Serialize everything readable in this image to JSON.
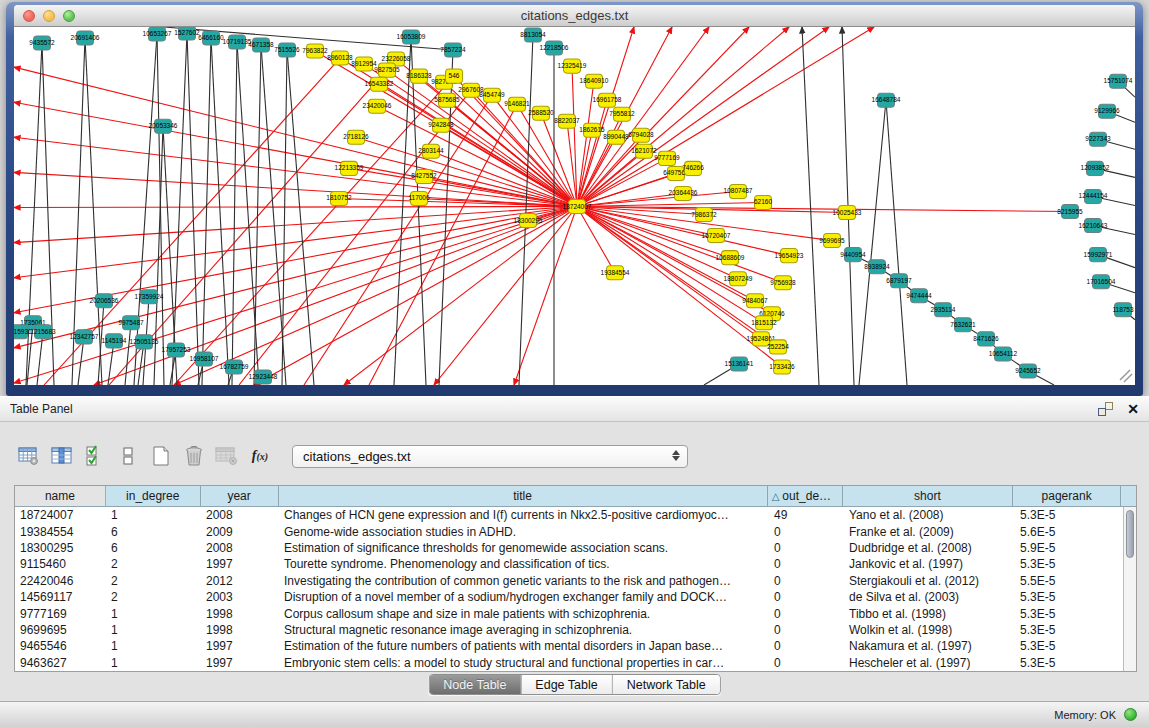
{
  "window": {
    "title": "citations_edges.txt",
    "traffic_lights": [
      "close",
      "minimize",
      "zoom"
    ]
  },
  "table_panel": {
    "title": "Table Panel",
    "header_icons": [
      "float-panel-icon",
      "close-panel-icon"
    ],
    "toolbar": {
      "icons": [
        "table-options-icon",
        "show-column-icon",
        "select-all-columns-icon",
        "row-height-icon",
        "new-table-icon",
        "delete-table-icon",
        "import-table-disabled-icon",
        "function-builder-icon"
      ],
      "table_selector_value": "citations_edges.txt"
    },
    "table": {
      "columns": [
        {
          "label": "name"
        },
        {
          "label": "in_degree"
        },
        {
          "label": "year"
        },
        {
          "label": "title"
        },
        {
          "label": "out_de…",
          "sort_indicator": "△"
        },
        {
          "label": "short"
        },
        {
          "label": "pagerank"
        }
      ],
      "rows": [
        {
          "name": "18724007",
          "in_degree": "1",
          "year": "2008",
          "title": "Changes of HCN gene expression and I(f) currents in Nkx2.5-positive cardiomyoc…",
          "out_degree": "49",
          "short": "Yano et al. (2008)",
          "pagerank": "5.3E-5"
        },
        {
          "name": "19384554",
          "in_degree": "6",
          "year": "2009",
          "title": "Genome-wide association studies in ADHD.",
          "out_degree": "0",
          "short": "Franke et al. (2009)",
          "pagerank": "5.6E-5"
        },
        {
          "name": "18300295",
          "in_degree": "6",
          "year": "2008",
          "title": "Estimation of significance thresholds for genomewide association scans.",
          "out_degree": "0",
          "short": "Dudbridge et al. (2008)",
          "pagerank": "5.9E-5"
        },
        {
          "name": "9115460",
          "in_degree": "2",
          "year": "1997",
          "title": "Tourette syndrome. Phenomenology and classification of tics.",
          "out_degree": "0",
          "short": "Jankovic et al. (1997)",
          "pagerank": "5.3E-5"
        },
        {
          "name": "22420046",
          "in_degree": "2",
          "year": "2012",
          "title": "Investigating the contribution of common genetic variants to the risk and pathogen…",
          "out_degree": "0",
          "short": "Stergiakouli et al. (2012)",
          "pagerank": "5.5E-5"
        },
        {
          "name": "14569117",
          "in_degree": "2",
          "year": "2003",
          "title": "Disruption of a novel member of a sodium/hydrogen exchanger family and DOCK…",
          "out_degree": "0",
          "short": "de Silva et al. (2003)",
          "pagerank": "5.3E-5"
        },
        {
          "name": "9777169",
          "in_degree": "1",
          "year": "1998",
          "title": "Corpus callosum shape and size in male patients with schizophrenia.",
          "out_degree": "0",
          "short": "Tibbo et al. (1998)",
          "pagerank": "5.3E-5"
        },
        {
          "name": "9699695",
          "in_degree": "1",
          "year": "1998",
          "title": "Structural magnetic resonance image averaging in schizophrenia.",
          "out_degree": "0",
          "short": "Wolkin et al. (1998)",
          "pagerank": "5.3E-5"
        },
        {
          "name": "9465546",
          "in_degree": "1",
          "year": "1997",
          "title": "Estimation of the future numbers of patients with mental disorders in Japan base…",
          "out_degree": "0",
          "short": "Nakamura et al. (1997)",
          "pagerank": "5.3E-5"
        },
        {
          "name": "9463627",
          "in_degree": "1",
          "year": "1997",
          "title": "Embryonic stem cells: a model to study structural and functional properties in car…",
          "out_degree": "0",
          "short": "Hescheler et al. (1997)",
          "pagerank": "5.3E-5"
        }
      ]
    },
    "tabs": [
      {
        "label": "Node Table",
        "selected": true
      },
      {
        "label": "Edge Table",
        "selected": false
      },
      {
        "label": "Network Table",
        "selected": false
      }
    ]
  },
  "status_bar": {
    "memory_label": "Memory: OK",
    "status_color": "#35b335"
  },
  "colors": {
    "node_yellow": "#f7ee00",
    "node_yellow_border": "#a8a000",
    "node_teal": "#23a8a4",
    "node_teal_border": "#6f7f7f",
    "edge_red": "#ee1111",
    "edge_black": "#2f2f2f",
    "frame_blue": "#2b4885",
    "header_blue": "#c6e2ee"
  },
  "graph": {
    "nodes": [
      [
        "18724007",
        563,
        179,
        "y"
      ],
      [
        "7963822",
        301,
        24,
        "y"
      ],
      [
        "8960128",
        326,
        31,
        "y"
      ],
      [
        "8912954",
        350,
        37,
        "y"
      ],
      [
        "23226058",
        382,
        32,
        "y"
      ],
      [
        "9827505",
        373,
        43,
        "y"
      ],
      [
        "16543382",
        365,
        57,
        "y"
      ],
      [
        "23420046",
        363,
        79,
        "y"
      ],
      [
        "8186328",
        405,
        49,
        "y"
      ],
      [
        "9827508",
        430,
        55,
        "y"
      ],
      [
        "546",
        440,
        49,
        "y"
      ],
      [
        "2967608",
        457,
        63,
        "y"
      ],
      [
        "5875685",
        433,
        73,
        "y"
      ],
      [
        "8454749",
        478,
        68,
        "y"
      ],
      [
        "9146821",
        503,
        77,
        "y"
      ],
      [
        "2588520",
        527,
        86,
        "y"
      ],
      [
        "8822037",
        553,
        94,
        "y"
      ],
      [
        "12325419",
        558,
        39,
        "y"
      ],
      [
        "18640910",
        580,
        54,
        "y"
      ],
      [
        "16961758",
        593,
        73,
        "y"
      ],
      [
        "1862615",
        578,
        103,
        "y"
      ],
      [
        "7955812",
        608,
        87,
        "y"
      ],
      [
        "8990448",
        602,
        110,
        "y"
      ],
      [
        "6794028",
        627,
        108,
        "y"
      ],
      [
        "1621072",
        630,
        124,
        "y"
      ],
      [
        "9777169",
        653,
        131,
        "y"
      ],
      [
        "6497568",
        662,
        146,
        "y"
      ],
      [
        "746266",
        679,
        141,
        "y"
      ],
      [
        "20364436",
        669,
        166,
        "y"
      ],
      [
        "10807487",
        724,
        164,
        "y"
      ],
      [
        "62160",
        749,
        175,
        "y"
      ],
      [
        "7986372",
        690,
        187,
        "y"
      ],
      [
        "16720407",
        702,
        208,
        "y"
      ],
      [
        "10025433",
        833,
        185,
        "y"
      ],
      [
        "10688609",
        716,
        230,
        "y"
      ],
      [
        "18807249",
        724,
        251,
        "y"
      ],
      [
        "19654923",
        775,
        228,
        "y"
      ],
      [
        "9699695",
        818,
        213,
        "y"
      ],
      [
        "9756928",
        769,
        255,
        "y"
      ],
      [
        "9484067",
        741,
        273,
        "y"
      ],
      [
        "6120746",
        758,
        286,
        "y"
      ],
      [
        "1815132",
        750,
        295,
        "y"
      ],
      [
        "19524861",
        747,
        311,
        "y"
      ],
      [
        "252254",
        764,
        319,
        "y"
      ],
      [
        "1733426",
        768,
        339,
        "y"
      ],
      [
        "19384554",
        601,
        245,
        "y"
      ],
      [
        "18300295",
        514,
        193,
        "y"
      ],
      [
        "2718126",
        342,
        110,
        "y"
      ],
      [
        "12213359",
        335,
        141,
        "y"
      ],
      [
        "2803144",
        417,
        124,
        "y"
      ],
      [
        "9242848",
        427,
        98,
        "y"
      ],
      [
        "8427552",
        410,
        149,
        "y"
      ],
      [
        "1810752",
        325,
        171,
        "y"
      ],
      [
        "117006",
        405,
        171,
        "y"
      ],
      [
        "9435572",
        28,
        16,
        "t"
      ],
      [
        "20691406",
        71,
        11,
        "t"
      ],
      [
        "10653267",
        143,
        7,
        "t"
      ],
      [
        "1527602",
        173,
        6,
        "t"
      ],
      [
        "6466160",
        197,
        11,
        "t"
      ],
      [
        "10719135",
        223,
        15,
        "t"
      ],
      [
        "4671358",
        247,
        18,
        "t"
      ],
      [
        "7515526",
        273,
        23,
        "t"
      ],
      [
        "16053809",
        397,
        10,
        "t"
      ],
      [
        "7857224",
        439,
        23,
        "t"
      ],
      [
        "8813054",
        519,
        8,
        "t"
      ],
      [
        "12218506",
        540,
        21,
        "t"
      ],
      [
        "20053346",
        149,
        99,
        "t"
      ],
      [
        "1735061",
        19,
        295,
        "t"
      ],
      [
        "3915931",
        5,
        304,
        "t"
      ],
      [
        "1215683",
        29,
        304,
        "t"
      ],
      [
        "20206536",
        90,
        273,
        "t"
      ],
      [
        "17359924",
        135,
        269,
        "t"
      ],
      [
        "9975487",
        117,
        295,
        "t"
      ],
      [
        "12342757",
        70,
        309,
        "t"
      ],
      [
        "1145194",
        100,
        313,
        "t"
      ],
      [
        "12505135",
        130,
        314,
        "t"
      ],
      [
        "17957253",
        162,
        322,
        "t"
      ],
      [
        "16958107",
        190,
        331,
        "t"
      ],
      [
        "16782759",
        220,
        339,
        "t"
      ],
      [
        "12923448",
        249,
        349,
        "t"
      ],
      [
        "16648784",
        872,
        73,
        "t"
      ],
      [
        "15751074",
        1104,
        54,
        "t"
      ],
      [
        "9129966",
        1093,
        84,
        "t"
      ],
      [
        "9227343",
        1084,
        112,
        "t"
      ],
      [
        "12093852",
        1081,
        141,
        "t"
      ],
      [
        "12444154",
        1079,
        169,
        "t"
      ],
      [
        "8215955",
        1056,
        184,
        "t"
      ],
      [
        "16210643",
        1079,
        198,
        "t"
      ],
      [
        "9440954",
        839,
        227,
        "t"
      ],
      [
        "8938924",
        863,
        239,
        "t"
      ],
      [
        "6879197",
        885,
        253,
        "t"
      ],
      [
        "9474444",
        905,
        268,
        "t"
      ],
      [
        "2935114",
        929,
        282,
        "t"
      ],
      [
        "7632621",
        949,
        297,
        "t"
      ],
      [
        "8471626",
        972,
        311,
        "t"
      ],
      [
        "10654112",
        989,
        326,
        "t"
      ],
      [
        "9245652",
        1014,
        343,
        "t"
      ],
      [
        "15136141",
        725,
        336,
        "t"
      ],
      [
        "15992971",
        1084,
        227,
        "t"
      ],
      [
        "17016504",
        1087,
        254,
        "t"
      ],
      [
        "118753",
        1109,
        282,
        "t"
      ]
    ],
    "edges": [
      "18724007>7963822:r",
      "18724007>8960128:r",
      "18724007>8912954:r",
      "18724007>23226058:r",
      "18724007>9827505:r",
      "18724007>16543382:r",
      "18724007>23420046:r",
      "18724007>8186328:r",
      "18724007>9827508:r",
      "18724007>546:r",
      "18724007>2967608:r",
      "18724007>5875685:r",
      "18724007>8454749:r",
      "18724007>9146821:r",
      "18724007>2588520:r",
      "18724007>8822037:r",
      "18724007>12325419:r",
      "18724007>18640910:r",
      "18724007>16961758:r",
      "18724007>1862615:r",
      "18724007>7955812:r",
      "18724007>8990448:r",
      "18724007>6794028:r",
      "18724007>1621072:r",
      "18724007>9777169:r",
      "18724007>6497568:r",
      "18724007>746266:r",
      "18724007>20364436:r",
      "18724007>10807487:r",
      "18724007>62160:r",
      "18724007>7986372:r",
      "18724007>16720407:r",
      "18724007>10025433:r",
      "18724007>10688609:r",
      "18724007>18807249:r",
      "18724007>19654923:r",
      "18724007>9699695:r",
      "18724007>9756928:r",
      "18724007>9484067:r",
      "18724007>6120746:r",
      "18724007>1815132:r",
      "18724007>19524861:r",
      "18724007>252254:r",
      "18724007>1733426:r",
      "18724007>19384554:r",
      "18724007>18300295:r",
      "18724007>2718126:r",
      "18724007>12213359:r",
      "18724007>2803144:r",
      "18724007>9242848:r",
      "18724007>8427552:r",
      "18724007>1810752:r",
      "18724007>117006:r",
      "18724007>0,40:r",
      "18724007>0,75:r",
      "18724007>0,110:r",
      "18724007>0,145:r",
      "18724007>0,180:r",
      "18724007>0,215:r",
      "18724007>0,250:r",
      "18724007>0,285:r",
      "18724007>0,320:r",
      "18724007>0,355:r",
      "18724007>80,357:r",
      "18724007>160,357:r",
      "18724007>240,357:r",
      "18724007>330,357:r",
      "18724007>420,357:r",
      "18724007>500,357:r",
      "18724007>620,0:r",
      "18724007>658,0:r",
      "18724007>695,0:r",
      "18724007>735,0:r",
      "18724007>775,0:r",
      "18724007>815,0:r",
      "18724007>860,0:r",
      "18724007>8215955:r",
      "30,357>8960128:r",
      "95,357>23226058:r",
      "160,357>546:r",
      "225,357>2967608:r",
      "290,357>8454749:r",
      "355,357>9146821:r",
      "12,357>9435572:k",
      "40,357>9435572:k",
      "58,357>20691406:k",
      "88,357>20691406:k",
      "120,357>10653267:k",
      "150,357>10653267:k",
      "158,357>1527602:k",
      "185,357>1527602:k",
      "188,357>6466160:k",
      "215,357>6466160:k",
      "218,357>10719135:k",
      "245,357>10719135:k",
      "240,357>4671358:k",
      "272,357>4671358:k",
      "268,357>7515526:k",
      "300,357>7515526:k",
      "380,357>16053809:k",
      "412,357>16053809:k",
      "425,357>7857224:k",
      "150,0>7857224:k",
      "505,357>8813054:k",
      "540,357>12218506:k",
      "140,357>20053346:k",
      "163,357>20053346:k",
      "13,357>1735061:k",
      "23,357>1215683:k",
      "84,357>20206536:k",
      "129,357>17359924:k",
      "111,357>9975487:k",
      "64,357>12342757:k",
      "94,357>1145194:k",
      "124,357>12505135:k",
      "156,357>17957253:k",
      "184,357>16958107:k",
      "214,357>16782759:k",
      "243,357>12923448:k",
      "8938924>9440954:k",
      "6879197>8938924:k",
      "9474444>6879197:k",
      "2935114>9474444:k",
      "7632621>2935114:k",
      "8471626>7632621:k",
      "10654112>8471626:k",
      "9245652>10654112:k",
      "1040,357>9245652:k",
      "690,357>15136141:k",
      "845,357>16648784:k",
      "893,357>16648784:k",
      "1121,70>15751074:k",
      "1121,95>9129966:k",
      "1121,122>9227343:k",
      "1121,150>12093852:k",
      "1121,178>12444154:k",
      "1121,207>16210643:k",
      "1121,240>15992971:k",
      "1121,265>17016504:k",
      "1121,292>118753:k",
      "805,357>788,0:k",
      "840,357>828,0:k"
    ]
  }
}
